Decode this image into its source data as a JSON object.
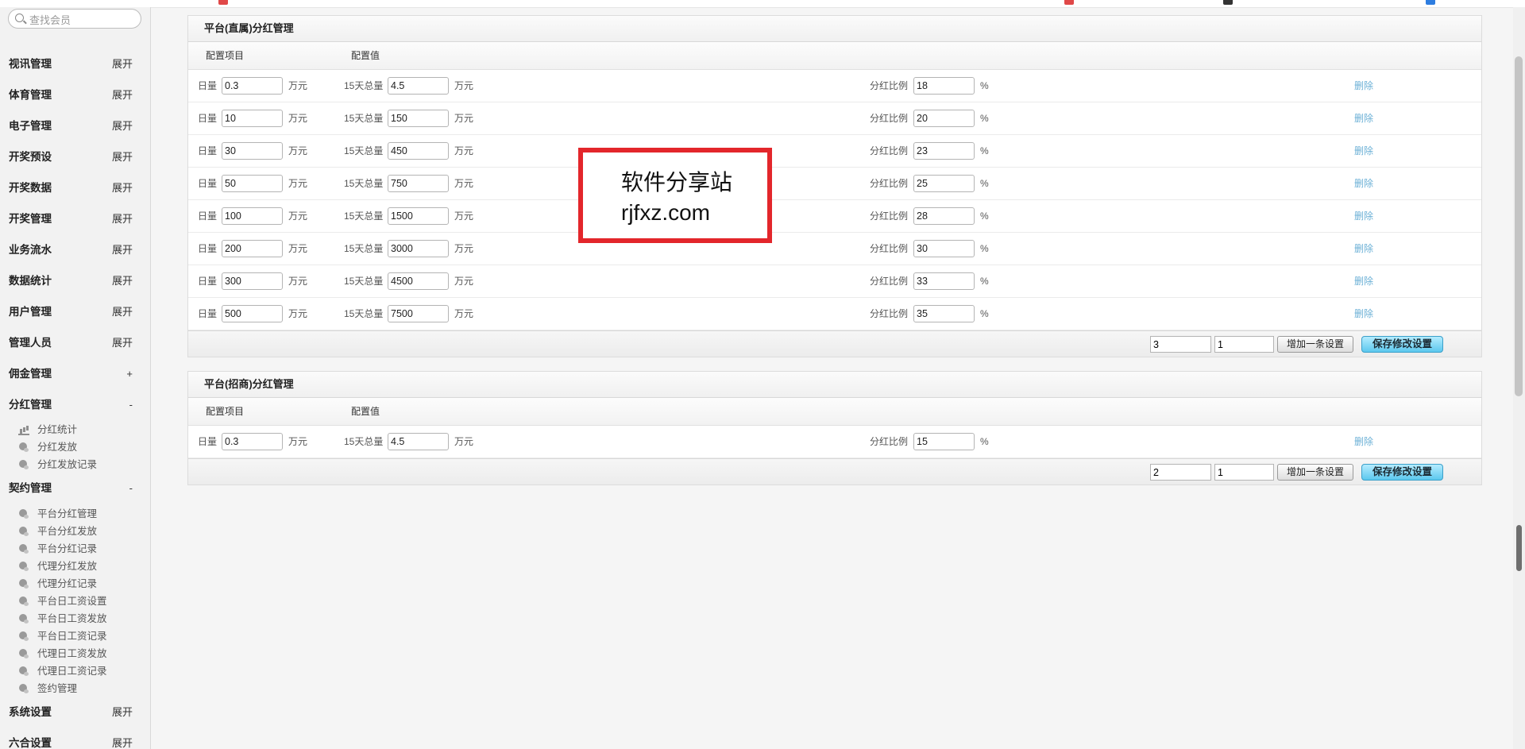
{
  "search": {
    "placeholder": "查找会员"
  },
  "sidebar": {
    "groups": [
      {
        "label": "视讯管理",
        "action": "展开"
      },
      {
        "label": "体育管理",
        "action": "展开"
      },
      {
        "label": "电子管理",
        "action": "展开"
      },
      {
        "label": "开奖预设",
        "action": "展开"
      },
      {
        "label": "开奖数据",
        "action": "展开"
      },
      {
        "label": "开奖管理",
        "action": "展开"
      },
      {
        "label": "业务流水",
        "action": "展开"
      },
      {
        "label": "数据统计",
        "action": "展开"
      },
      {
        "label": "用户管理",
        "action": "展开"
      },
      {
        "label": "管理人员",
        "action": "展开"
      },
      {
        "label": "佣金管理",
        "action": "+"
      },
      {
        "label": "分红管理",
        "action": "-"
      },
      {
        "label": "契约管理",
        "action": "-"
      },
      {
        "label": "系统设置",
        "action": "展开"
      },
      {
        "label": "六合设置",
        "action": "展开"
      }
    ],
    "fenhong_items": [
      "分红统计",
      "分红发放",
      "分红发放记录"
    ],
    "qiyue_items": [
      "平台分红管理",
      "平台分红发放",
      "平台分红记录",
      "代理分红发放",
      "代理分红记录",
      "平台日工资设置",
      "平台日工资发放",
      "平台日工资记录",
      "代理日工资发放",
      "代理日工资记录",
      "签约管理"
    ]
  },
  "labels": {
    "col_item": "配置项目",
    "col_value": "配置值",
    "daily": "日量",
    "unit": "万元",
    "total15": "15天总量",
    "ratio": "分红比例",
    "percent": "%",
    "delete": "删除",
    "add_button": "增加一条设置",
    "save_button": "保存修改设置"
  },
  "panel1": {
    "title": "平台(直属)分红管理",
    "rows": [
      {
        "daily": "0.3",
        "total": "4.5",
        "ratio": "18"
      },
      {
        "daily": "10",
        "total": "150",
        "ratio": "20"
      },
      {
        "daily": "30",
        "total": "450",
        "ratio": "23"
      },
      {
        "daily": "50",
        "total": "750",
        "ratio": "25"
      },
      {
        "daily": "100",
        "total": "1500",
        "ratio": "28"
      },
      {
        "daily": "200",
        "total": "3000",
        "ratio": "30"
      },
      {
        "daily": "300",
        "total": "4500",
        "ratio": "33"
      },
      {
        "daily": "500",
        "total": "7500",
        "ratio": "35"
      }
    ],
    "footer": {
      "a": "3",
      "b": "1"
    }
  },
  "panel2": {
    "title": "平台(招商)分红管理",
    "rows": [
      {
        "daily": "0.3",
        "total": "4.5",
        "ratio": "15"
      }
    ],
    "footer": {
      "a": "2",
      "b": "1"
    }
  },
  "watermark": {
    "line1": "软件分享站",
    "line2": "rjfxz.com"
  },
  "colors": {
    "accent": "#5cc8ee",
    "watermark_border": "#e3262b",
    "link": "#6bb0d6"
  }
}
